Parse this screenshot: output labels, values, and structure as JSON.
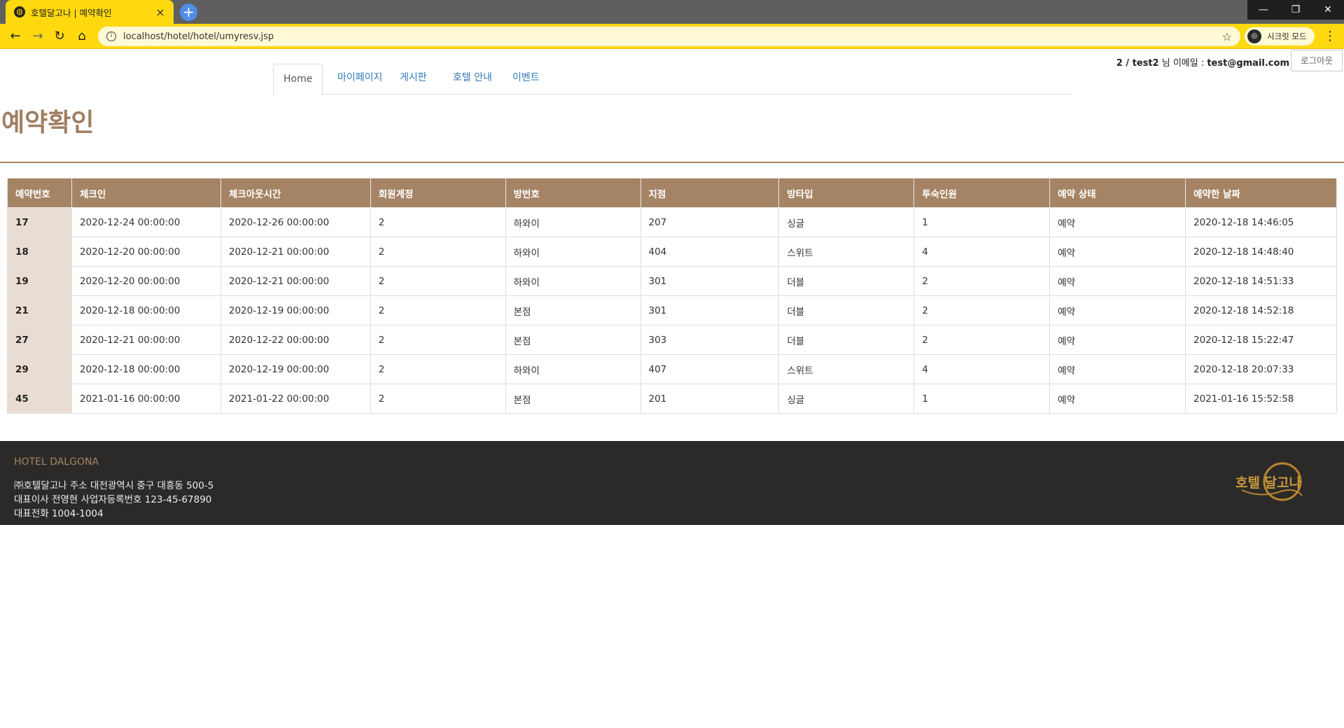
{
  "browser": {
    "tab_title": "호텔달고나 | 예약확인",
    "url": "localhost/hotel/hotel/umyresv.jsp",
    "profile_label": "시크릿 모드"
  },
  "header": {
    "user_id": "2 / test2",
    "user_suffix": " 님 이메일 : ",
    "user_email": "test@gmail.com",
    "logout_label": "로그아웃"
  },
  "nav": {
    "tabs": [
      {
        "label": "Home"
      },
      {
        "label": "마이페이지"
      },
      {
        "label": "게시판"
      },
      {
        "label": "호텔 안내"
      },
      {
        "label": "이벤트"
      }
    ]
  },
  "page_title": "예약확인",
  "table": {
    "headers": [
      "예약번호",
      "체크인",
      "체크아웃시간",
      "회원계정",
      "방번호",
      "지점",
      "방타입",
      "투숙인원",
      "예약 상태",
      "예약한 날짜"
    ],
    "rows": [
      [
        "17",
        "2020-12-24 00:00:00",
        "2020-12-26 00:00:00",
        "2",
        "하와이",
        "207",
        "싱글",
        "1",
        "예약",
        "2020-12-18 14:46:05"
      ],
      [
        "18",
        "2020-12-20 00:00:00",
        "2020-12-21 00:00:00",
        "2",
        "하와이",
        "404",
        "스위트",
        "4",
        "예약",
        "2020-12-18 14:48:40"
      ],
      [
        "19",
        "2020-12-20 00:00:00",
        "2020-12-21 00:00:00",
        "2",
        "하와이",
        "301",
        "더블",
        "2",
        "예약",
        "2020-12-18 14:51:33"
      ],
      [
        "21",
        "2020-12-18 00:00:00",
        "2020-12-19 00:00:00",
        "2",
        "본점",
        "301",
        "더블",
        "2",
        "예약",
        "2020-12-18 14:52:18"
      ],
      [
        "27",
        "2020-12-21 00:00:00",
        "2020-12-22 00:00:00",
        "2",
        "본점",
        "303",
        "더블",
        "2",
        "예약",
        "2020-12-18 15:22:47"
      ],
      [
        "29",
        "2020-12-18 00:00:00",
        "2020-12-19 00:00:00",
        "2",
        "하와이",
        "407",
        "스위트",
        "4",
        "예약",
        "2020-12-18 20:07:33"
      ],
      [
        "45",
        "2021-01-16 00:00:00",
        "2021-01-22 00:00:00",
        "2",
        "본점",
        "201",
        "싱글",
        "1",
        "예약",
        "2021-01-16 15:52:58"
      ]
    ]
  },
  "footer": {
    "brand": "HOTEL DALGONA",
    "line1": "㈜호텔달고나 주소 대전광역시 중구 대흥동 500-5",
    "line2": "대표이사 전영현 사업자등록번호 123-45-67890",
    "line3": "대표전화 1004-1004",
    "logo_text": "호텔 달고나"
  },
  "colors": {
    "accent": "#a58465",
    "footer_bg": "#2b2a29",
    "chrome_yellow": "#ffd90f"
  }
}
